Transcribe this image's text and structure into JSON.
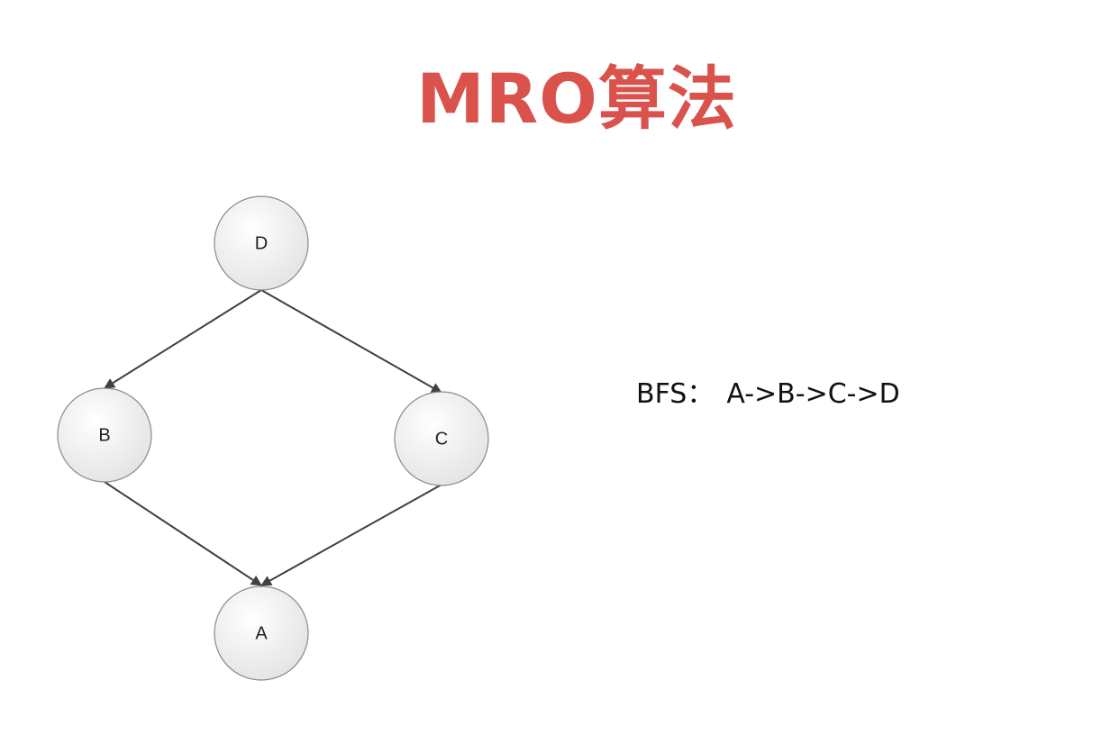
{
  "title": "MRO算法",
  "diagram": {
    "nodes": [
      {
        "id": "D",
        "label": "D"
      },
      {
        "id": "B",
        "label": "B"
      },
      {
        "id": "C",
        "label": "C"
      },
      {
        "id": "A",
        "label": "A"
      }
    ],
    "edges": [
      {
        "from": "D",
        "to": "B"
      },
      {
        "from": "D",
        "to": "C"
      },
      {
        "from": "B",
        "to": "A"
      },
      {
        "from": "C",
        "to": "A"
      }
    ]
  },
  "bfs": {
    "label": "BFS：",
    "order": "A->B->C->D"
  },
  "colors": {
    "title": "#d9534c",
    "node_fill_light": "#ffffff",
    "node_fill_dark": "#e3e3e3",
    "node_stroke": "#8a8a8a",
    "edge": "#404040"
  }
}
